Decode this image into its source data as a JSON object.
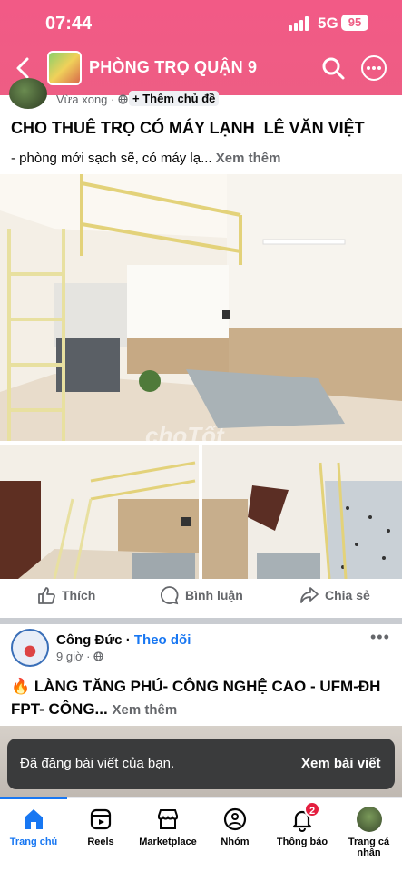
{
  "status": {
    "time": "07:44",
    "network": "5G",
    "battery": "95"
  },
  "header": {
    "title": "PHÒNG TRỌ QUẬN 9"
  },
  "post1": {
    "time": "Vừa xong",
    "add_topic": "+ Thêm chủ đề",
    "title": "CHO THUÊ TRỌ CÓ MÁY LẠNH  LÊ VĂN VIỆT",
    "description": "- phòng mới sạch sẽ, có máy lạ...",
    "see_more": "Xem thêm",
    "watermark": "choTốt"
  },
  "actions": {
    "like": "Thích",
    "comment": "Bình luận",
    "share": "Chia sẻ"
  },
  "post2": {
    "author": "Công Đức",
    "separator": "·",
    "follow": "Theo dõi",
    "time": "9 giờ ·",
    "more": "•••",
    "title": "🔥 LÀNG TĂNG PHÚ- CÔNG NGHỆ CAO - UFM-ĐH FPT- CÔNG...",
    "see_more": "Xem thêm"
  },
  "toast": {
    "message": "Đã đăng bài viết của bạn.",
    "action": "Xem bài viết"
  },
  "tabs": [
    {
      "label": "Trang chủ",
      "icon": "home-icon",
      "active": true
    },
    {
      "label": "Reels",
      "icon": "reels-icon"
    },
    {
      "label": "Marketplace",
      "icon": "marketplace-icon"
    },
    {
      "label": "Nhóm",
      "icon": "groups-icon"
    },
    {
      "label": "Thông báo",
      "icon": "bell-icon",
      "badge": "2"
    },
    {
      "label": "Trang cá nhân",
      "icon": "profile-avatar"
    }
  ],
  "colors": {
    "header": "#ee5d84",
    "accent": "#1877f2",
    "badge": "#e41e3f",
    "toast": "#3a3b3c"
  }
}
